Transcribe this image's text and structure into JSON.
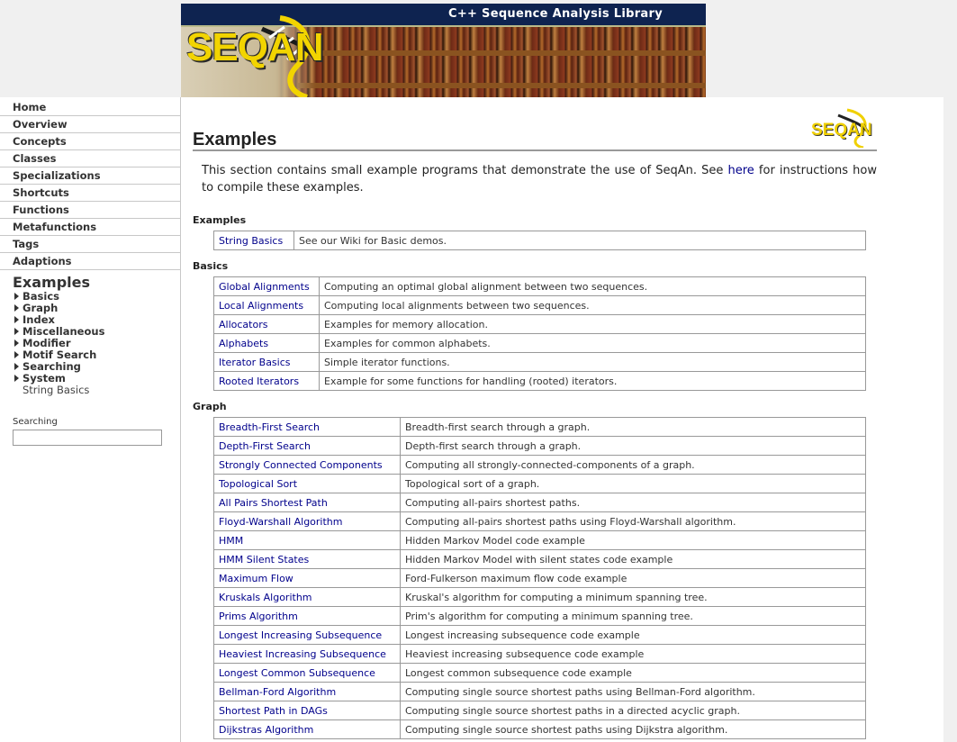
{
  "header": {
    "title": "C++ Sequence Analysis Library",
    "logo_text": "SEQAN"
  },
  "sidebar": {
    "nav_items": [
      {
        "label": "Home",
        "name": "home"
      },
      {
        "label": "Overview",
        "name": "overview"
      },
      {
        "label": "Concepts",
        "name": "concepts"
      },
      {
        "label": "Classes",
        "name": "classes"
      },
      {
        "label": "Specializations",
        "name": "specializations"
      },
      {
        "label": "Shortcuts",
        "name": "shortcuts"
      },
      {
        "label": "Functions",
        "name": "functions"
      },
      {
        "label": "Metafunctions",
        "name": "metafunctions"
      },
      {
        "label": "Tags",
        "name": "tags"
      },
      {
        "label": "Adaptions",
        "name": "adaptions"
      }
    ],
    "current": "Examples",
    "sub_items": [
      {
        "label": "Basics",
        "name": "basics"
      },
      {
        "label": "Graph",
        "name": "graph"
      },
      {
        "label": "Index",
        "name": "index"
      },
      {
        "label": "Miscellaneous",
        "name": "miscellaneous"
      },
      {
        "label": "Modifier",
        "name": "modifier"
      },
      {
        "label": "Motif Search",
        "name": "motif-search"
      },
      {
        "label": "Searching",
        "name": "searching"
      },
      {
        "label": "System",
        "name": "system"
      }
    ],
    "plain_item": "String Basics",
    "search_label": "Searching",
    "search_value": ""
  },
  "main": {
    "logo_text": "SEQAN",
    "title": "Examples",
    "intro_before": "This section contains small example programs that demonstrate the use of SeqAn. See ",
    "intro_link": "here",
    "intro_after": " for instructions how to compile these examples.",
    "sections": [
      {
        "heading": "Examples",
        "name": "examples",
        "col1_width": 78,
        "rows": [
          {
            "link": "String Basics",
            "desc": "See our Wiki for Basic demos."
          }
        ]
      },
      {
        "heading": "Basics",
        "name": "basics",
        "col1_width": 106,
        "rows": [
          {
            "link": "Global Alignments",
            "desc": "Computing an optimal global alignment between two sequences."
          },
          {
            "link": "Local Alignments",
            "desc": "Computing local alignments between two sequences."
          },
          {
            "link": "Allocators",
            "desc": "Examples for memory allocation."
          },
          {
            "link": "Alphabets",
            "desc": "Examples for common alphabets."
          },
          {
            "link": "Iterator Basics",
            "desc": "Simple iterator functions."
          },
          {
            "link": "Rooted Iterators",
            "desc": "Example for some functions for handling (rooted) iterators."
          }
        ]
      },
      {
        "heading": "Graph",
        "name": "graph",
        "col1_width": 196,
        "rows": [
          {
            "link": "Breadth-First Search",
            "desc": "Breadth-first search through a graph."
          },
          {
            "link": "Depth-First Search",
            "desc": "Depth-first search through a graph."
          },
          {
            "link": "Strongly Connected Components",
            "desc": "Computing all strongly-connected-components of a graph."
          },
          {
            "link": "Topological Sort",
            "desc": "Topological sort of a graph."
          },
          {
            "link": "All Pairs Shortest Path",
            "desc": "Computing all-pairs shortest paths."
          },
          {
            "link": "Floyd-Warshall Algorithm",
            "desc": "Computing all-pairs shortest paths using Floyd-Warshall algorithm."
          },
          {
            "link": "HMM",
            "desc": "Hidden Markov Model code example"
          },
          {
            "link": "HMM Silent States",
            "desc": "Hidden Markov Model with silent states code example"
          },
          {
            "link": "Maximum Flow",
            "desc": "Ford-Fulkerson maximum flow code example"
          },
          {
            "link": "Kruskals Algorithm",
            "desc": "Kruskal's algorithm for computing a minimum spanning tree."
          },
          {
            "link": "Prims Algorithm",
            "desc": "Prim's algorithm for computing a minimum spanning tree."
          },
          {
            "link": "Longest Increasing Subsequence",
            "desc": "Longest increasing subsequence code example"
          },
          {
            "link": "Heaviest Increasing Subsequence",
            "desc": "Heaviest increasing subsequence code example"
          },
          {
            "link": "Longest Common Subsequence",
            "desc": "Longest common subsequence code example"
          },
          {
            "link": "Bellman-Ford Algorithm",
            "desc": "Computing single source shortest paths using Bellman-Ford algorithm."
          },
          {
            "link": "Shortest Path in DAGs",
            "desc": "Computing single source shortest paths in a directed acyclic graph."
          },
          {
            "link": "Dijkstras Algorithm",
            "desc": "Computing single source shortest paths using Dijkstra algorithm."
          }
        ]
      }
    ]
  }
}
